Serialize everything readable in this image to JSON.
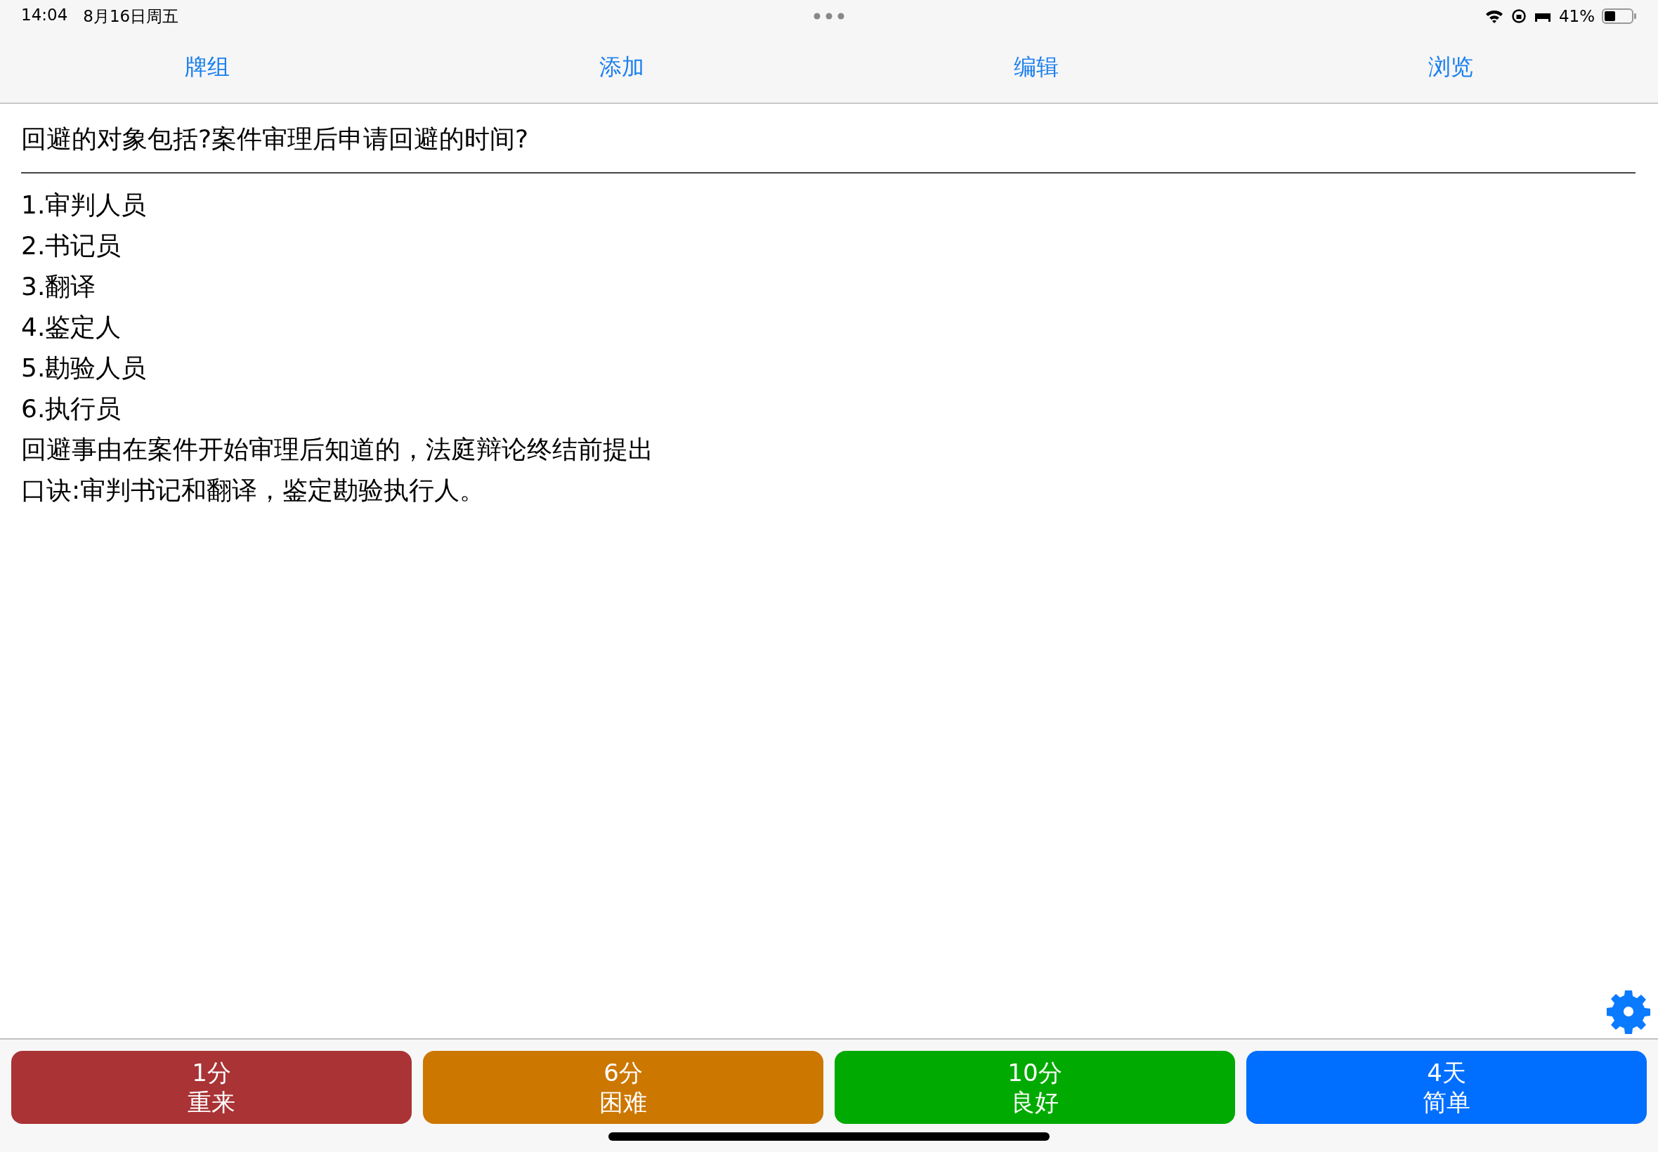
{
  "status_bar": {
    "time": "14:04",
    "date": "8月16日周五",
    "battery": "41%"
  },
  "nav_tabs": [
    "牌组",
    "添加",
    "编辑",
    "浏览"
  ],
  "card": {
    "question": "回避的对象包括?案件审理后申请回避的时间?",
    "answer_lines": [
      "1.审判人员",
      "2.书记员",
      "3.翻译",
      "4.鉴定人",
      "5.勘验人员",
      "6.执行员",
      "回避事由在案件开始审理后知道的，法庭辩论终结前提出",
      "口诀:审判书记和翻译，鉴定勘验执行人。"
    ]
  },
  "answer_buttons": [
    {
      "interval": "1分",
      "label": "重来",
      "color": "#a93335"
    },
    {
      "interval": "6分",
      "label": "困难",
      "color": "#cc7700"
    },
    {
      "interval": "10分",
      "label": "良好",
      "color": "#00aa00"
    },
    {
      "interval": "4天",
      "label": "简单",
      "color": "#006eff"
    }
  ]
}
